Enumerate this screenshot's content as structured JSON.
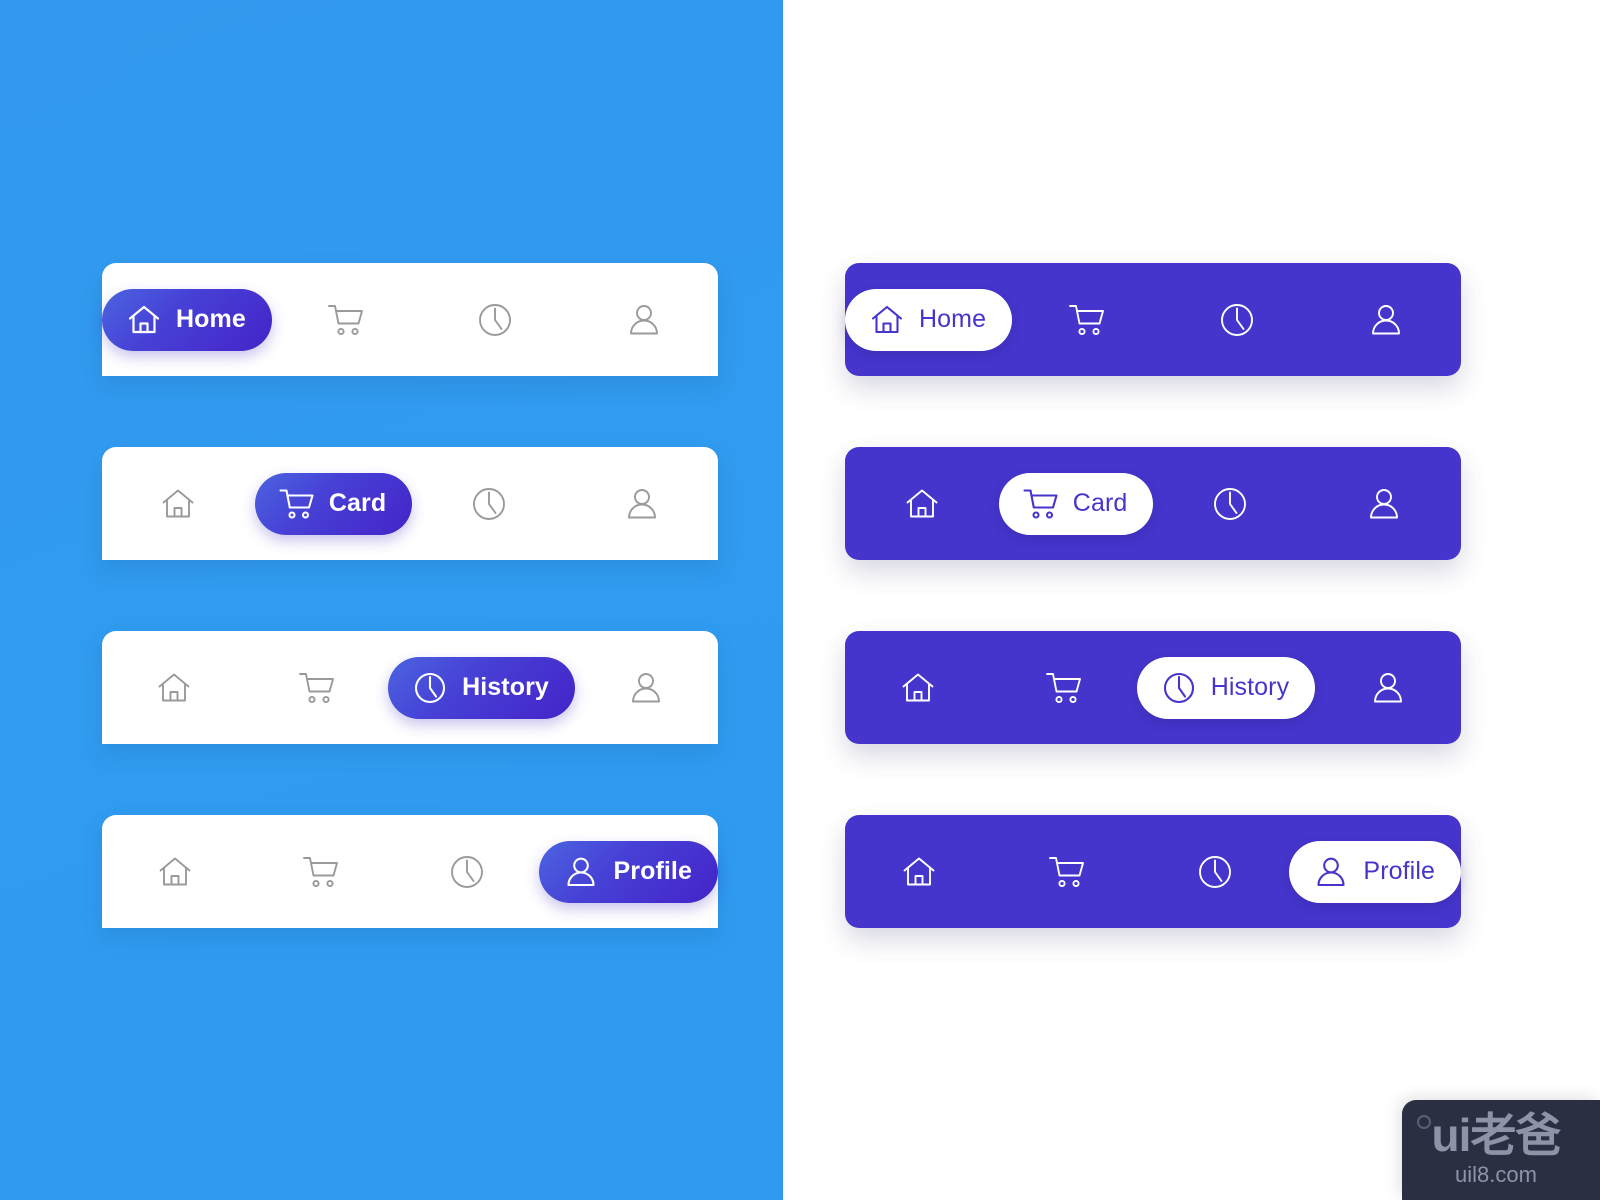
{
  "theme": {
    "left_background": "#309BEF",
    "right_background": "#FFFFFF",
    "bar_light": "#FFFFFF",
    "bar_dark": "#4535CC",
    "accent_gradient_start": "#4B64E0",
    "accent_gradient_end": "#4423C8",
    "inactive_icon": "#9A9A9A",
    "active_text_on_dark": "#FFFFFF",
    "active_text_on_light": "#4535CC"
  },
  "nav_labels": {
    "home": "Home",
    "card": "Card",
    "history": "History",
    "profile": "Profile"
  },
  "icons": {
    "home": "home-icon",
    "card": "shopping-cart-icon",
    "history": "clock-icon",
    "profile": "user-icon"
  },
  "panels": [
    {
      "id": "light-bars",
      "style": "light",
      "bars": [
        {
          "active": "home",
          "items": [
            "home",
            "card",
            "history",
            "profile"
          ]
        },
        {
          "active": "card",
          "items": [
            "home",
            "card",
            "history",
            "profile"
          ]
        },
        {
          "active": "history",
          "items": [
            "home",
            "card",
            "history",
            "profile"
          ]
        },
        {
          "active": "profile",
          "items": [
            "home",
            "card",
            "history",
            "profile"
          ]
        }
      ]
    },
    {
      "id": "dark-bars",
      "style": "dark",
      "bars": [
        {
          "active": "home",
          "items": [
            "home",
            "card",
            "history",
            "profile"
          ]
        },
        {
          "active": "card",
          "items": [
            "home",
            "card",
            "history",
            "profile"
          ]
        },
        {
          "active": "history",
          "items": [
            "home",
            "card",
            "history",
            "profile"
          ]
        },
        {
          "active": "profile",
          "items": [
            "home",
            "card",
            "history",
            "profile"
          ]
        }
      ]
    }
  ],
  "watermark": {
    "main": "ui老爸",
    "sub": "uil8.com"
  }
}
